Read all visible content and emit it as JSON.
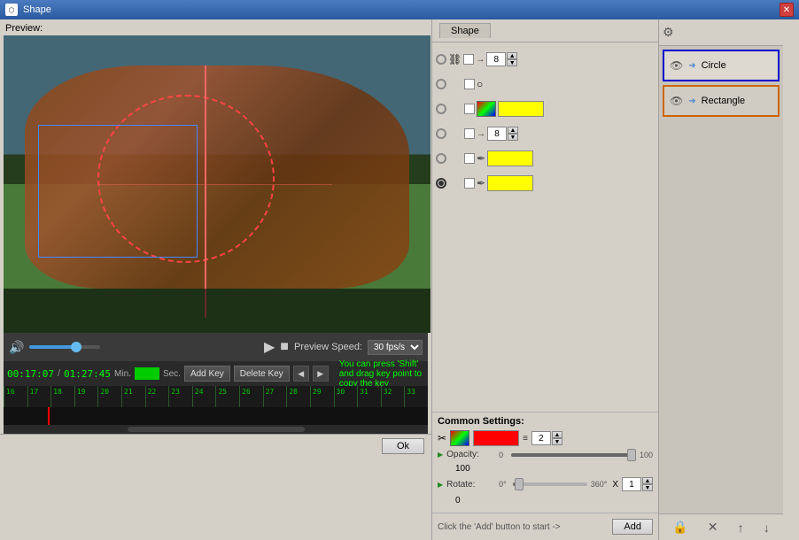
{
  "window": {
    "title": "Shape",
    "close_label": "✕"
  },
  "preview": {
    "label": "Preview:"
  },
  "controls": {
    "play": "▶",
    "stop": "■",
    "fps_label": "Preview Speed:",
    "fps_value": "30 fps/s"
  },
  "timeline": {
    "current_time": "00:17:07",
    "total_time": "01:27:45",
    "min_label": "Min.",
    "sec_label": "Sec.",
    "add_key_label": "Add Key",
    "delete_key_label": "Delete Key",
    "status_message": "You can press 'Shift' and drag key point to copy the key",
    "ruler_numbers": [
      "16",
      "17",
      "18",
      "19",
      "20",
      "21",
      "22",
      "23",
      "24",
      "25",
      "26",
      "27",
      "28",
      "29",
      "30",
      "31",
      "32",
      "33"
    ]
  },
  "shape_panel": {
    "tab_label": "Shape",
    "rows": [
      {
        "radio": false,
        "checkbox": true,
        "arrow": true,
        "spin": "8",
        "has_up_down": true
      },
      {
        "radio": false,
        "checkbox": true,
        "circle_icon": true
      },
      {
        "radio": false,
        "checkbox": true,
        "color": true,
        "yellow": true
      },
      {
        "radio": false,
        "checkbox": true,
        "arrow": true,
        "spin": "8",
        "has_up_down": true
      },
      {
        "radio": false,
        "checkbox": true,
        "feather": true,
        "yellow": true
      },
      {
        "radio": true,
        "checkbox": true,
        "feather": true,
        "yellow": true
      }
    ],
    "common_settings": {
      "title": "Common Settings:",
      "opacity_label": "Opacity:",
      "opacity_min": "0",
      "opacity_max": "100",
      "opacity_value": "100",
      "rotate_label": "Rotate:",
      "rotate_min": "0°",
      "rotate_max": "360°",
      "rotate_x_label": "X",
      "rotate_spin": "1",
      "rotate_value": "0"
    },
    "add_hint": "Click the 'Add' button to start ->",
    "add_button": "Add"
  },
  "shape_list": {
    "items": [
      {
        "name": "Circle",
        "selected": true,
        "visible": true
      },
      {
        "name": "Rectangle",
        "selected": false,
        "visible": true,
        "orange": true
      }
    ],
    "bottom_buttons": [
      "🔒",
      "✕",
      "↑",
      "↓"
    ]
  },
  "bottom": {
    "ok_label": "Ok"
  }
}
